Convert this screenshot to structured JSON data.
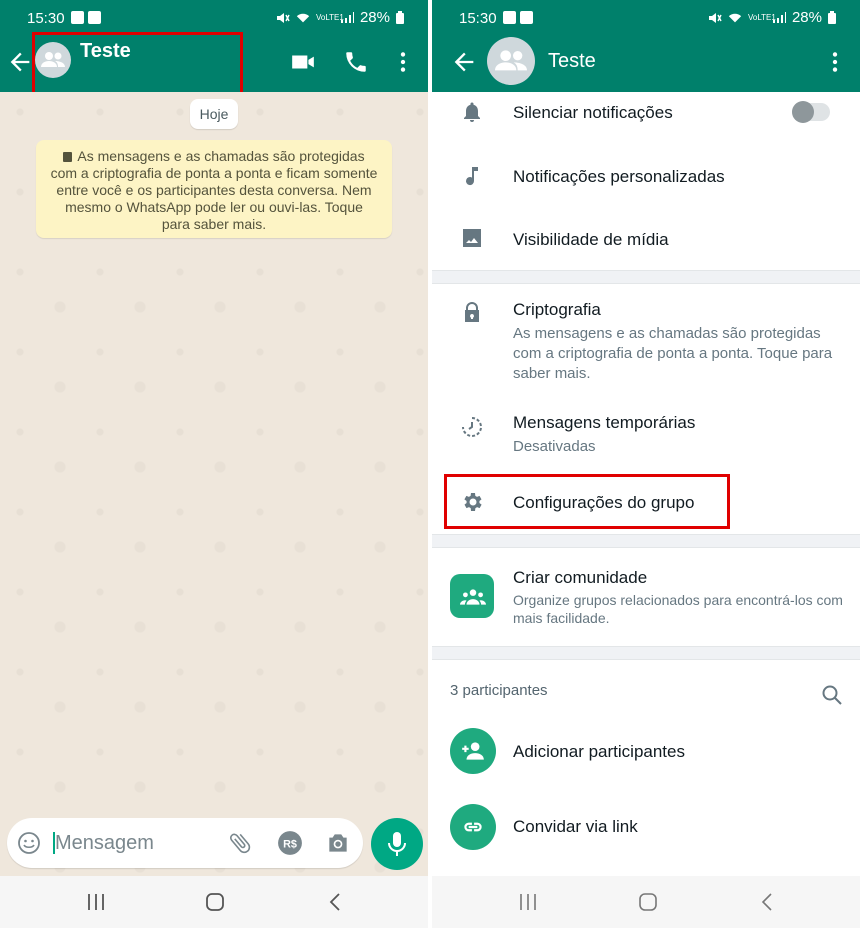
{
  "status_bar": {
    "time": "15:30",
    "battery": "28%",
    "network": "VoLTE1"
  },
  "left": {
    "header": {
      "title": "Teste"
    },
    "date_chip": "Hoje",
    "encryption_notice": "As mensagens e as chamadas são protegidas com a criptografia de ponta a ponta e ficam somente entre você e os participantes desta conversa. Nem mesmo o WhatsApp pode ler ou ouvi-las. Toque para saber mais.",
    "input": {
      "placeholder": "Mensagem"
    }
  },
  "right": {
    "header": {
      "title": "Teste"
    },
    "settings_rows": [
      {
        "title": "Silenciar notificações",
        "icon": "bell-icon",
        "toggle_on": false
      },
      {
        "title": "Notificações personalizadas",
        "icon": "music-note-icon"
      },
      {
        "title": "Visibilidade de mídia",
        "icon": "image-icon"
      }
    ],
    "privacy_rows": [
      {
        "title": "Criptografia",
        "subtitle": "As mensagens e as chamadas são protegidas com a criptografia de ponta a ponta. Toque para saber mais.",
        "icon": "lock-icon"
      },
      {
        "title": "Mensagens temporárias",
        "subtitle": "Desativadas",
        "icon": "timer-icon"
      },
      {
        "title": "Configurações do grupo",
        "icon": "gear-icon"
      }
    ],
    "community": {
      "title": "Criar comunidade",
      "subtitle": "Organize grupos relacionados para encontrá-los com mais facilidade."
    },
    "participants": {
      "label": "3 participantes",
      "add": "Adicionar participantes",
      "invite": "Convidar via link"
    }
  },
  "colors": {
    "header": "#00806b",
    "accent": "#00a884",
    "highlight": "#e00000"
  }
}
